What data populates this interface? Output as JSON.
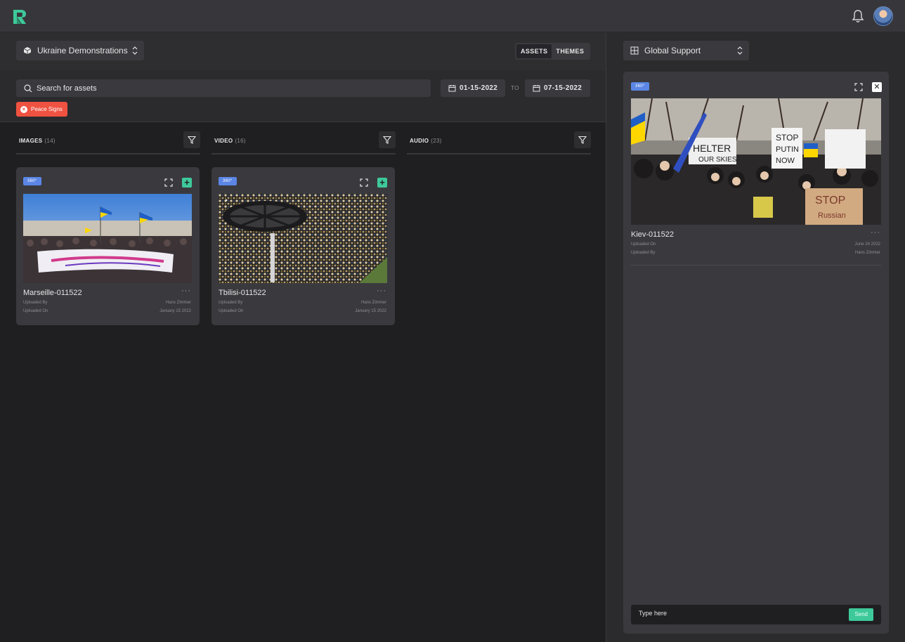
{
  "header": {
    "logo_icon": "r-logo-icon",
    "bell_icon": "bell-icon",
    "avatar": "user-avatar"
  },
  "project_select": {
    "value": "Ukraine Demonstrations",
    "icon": "cube-icon"
  },
  "view_toggle": {
    "assets": "ASSETS",
    "themes": "THEMES",
    "active": "assets"
  },
  "search": {
    "placeholder": "Search for assets"
  },
  "dates": {
    "from": "01-15-2022",
    "separator": "TO",
    "to": "07-15-2022"
  },
  "filter_chip": {
    "label": "Peace Signs"
  },
  "columns": [
    {
      "title": "IMAGES",
      "count": "(14)"
    },
    {
      "title": "VIDEO",
      "count": "(16)"
    },
    {
      "title": "AUDIO",
      "count": "(23)"
    }
  ],
  "cards": [
    {
      "badge": "360°",
      "name": "Marseille-011522",
      "menu": "···",
      "meta": [
        {
          "label": "Uploaded By",
          "value": "Hans Zimmer"
        },
        {
          "label": "Uploaded On",
          "value": "January 15 2022"
        }
      ]
    },
    {
      "badge": "360°",
      "name": "Tbilisi-011522",
      "menu": "···",
      "meta": [
        {
          "label": "Uploaded By",
          "value": "Hans Zimmer"
        },
        {
          "label": "Uploaded On",
          "value": "January 15 2022"
        }
      ]
    }
  ],
  "theme_select": {
    "value": "Global Support",
    "icon": "grid-icon"
  },
  "detail": {
    "badge": "360°",
    "name": "Kiev-011522",
    "menu": "···",
    "close": "✕",
    "meta": [
      {
        "label": "Uploaded On",
        "value": "June 24 2022"
      },
      {
        "label": "Uploaded By",
        "value": "Hans Zimmer"
      }
    ],
    "chat_placeholder": "Type here",
    "send_label": "Send"
  },
  "colors": {
    "accent": "#3ec99a",
    "badge": "#5b86e5",
    "chip": "#ef5240"
  }
}
